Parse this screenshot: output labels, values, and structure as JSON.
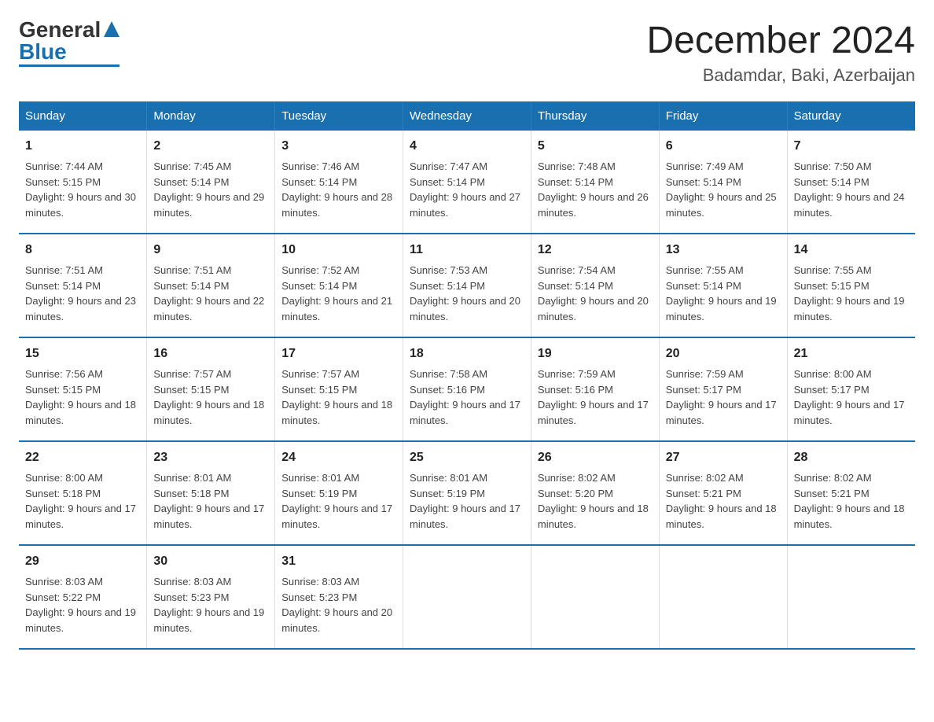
{
  "header": {
    "logo_general": "General",
    "logo_blue": "Blue",
    "main_title": "December 2024",
    "subtitle": "Badamdar, Baki, Azerbaijan"
  },
  "days_of_week": [
    "Sunday",
    "Monday",
    "Tuesday",
    "Wednesday",
    "Thursday",
    "Friday",
    "Saturday"
  ],
  "weeks": [
    [
      {
        "day": "1",
        "sunrise": "7:44 AM",
        "sunset": "5:15 PM",
        "daylight": "9 hours and 30 minutes."
      },
      {
        "day": "2",
        "sunrise": "7:45 AM",
        "sunset": "5:14 PM",
        "daylight": "9 hours and 29 minutes."
      },
      {
        "day": "3",
        "sunrise": "7:46 AM",
        "sunset": "5:14 PM",
        "daylight": "9 hours and 28 minutes."
      },
      {
        "day": "4",
        "sunrise": "7:47 AM",
        "sunset": "5:14 PM",
        "daylight": "9 hours and 27 minutes."
      },
      {
        "day": "5",
        "sunrise": "7:48 AM",
        "sunset": "5:14 PM",
        "daylight": "9 hours and 26 minutes."
      },
      {
        "day": "6",
        "sunrise": "7:49 AM",
        "sunset": "5:14 PM",
        "daylight": "9 hours and 25 minutes."
      },
      {
        "day": "7",
        "sunrise": "7:50 AM",
        "sunset": "5:14 PM",
        "daylight": "9 hours and 24 minutes."
      }
    ],
    [
      {
        "day": "8",
        "sunrise": "7:51 AM",
        "sunset": "5:14 PM",
        "daylight": "9 hours and 23 minutes."
      },
      {
        "day": "9",
        "sunrise": "7:51 AM",
        "sunset": "5:14 PM",
        "daylight": "9 hours and 22 minutes."
      },
      {
        "day": "10",
        "sunrise": "7:52 AM",
        "sunset": "5:14 PM",
        "daylight": "9 hours and 21 minutes."
      },
      {
        "day": "11",
        "sunrise": "7:53 AM",
        "sunset": "5:14 PM",
        "daylight": "9 hours and 20 minutes."
      },
      {
        "day": "12",
        "sunrise": "7:54 AM",
        "sunset": "5:14 PM",
        "daylight": "9 hours and 20 minutes."
      },
      {
        "day": "13",
        "sunrise": "7:55 AM",
        "sunset": "5:14 PM",
        "daylight": "9 hours and 19 minutes."
      },
      {
        "day": "14",
        "sunrise": "7:55 AM",
        "sunset": "5:15 PM",
        "daylight": "9 hours and 19 minutes."
      }
    ],
    [
      {
        "day": "15",
        "sunrise": "7:56 AM",
        "sunset": "5:15 PM",
        "daylight": "9 hours and 18 minutes."
      },
      {
        "day": "16",
        "sunrise": "7:57 AM",
        "sunset": "5:15 PM",
        "daylight": "9 hours and 18 minutes."
      },
      {
        "day": "17",
        "sunrise": "7:57 AM",
        "sunset": "5:15 PM",
        "daylight": "9 hours and 18 minutes."
      },
      {
        "day": "18",
        "sunrise": "7:58 AM",
        "sunset": "5:16 PM",
        "daylight": "9 hours and 17 minutes."
      },
      {
        "day": "19",
        "sunrise": "7:59 AM",
        "sunset": "5:16 PM",
        "daylight": "9 hours and 17 minutes."
      },
      {
        "day": "20",
        "sunrise": "7:59 AM",
        "sunset": "5:17 PM",
        "daylight": "9 hours and 17 minutes."
      },
      {
        "day": "21",
        "sunrise": "8:00 AM",
        "sunset": "5:17 PM",
        "daylight": "9 hours and 17 minutes."
      }
    ],
    [
      {
        "day": "22",
        "sunrise": "8:00 AM",
        "sunset": "5:18 PM",
        "daylight": "9 hours and 17 minutes."
      },
      {
        "day": "23",
        "sunrise": "8:01 AM",
        "sunset": "5:18 PM",
        "daylight": "9 hours and 17 minutes."
      },
      {
        "day": "24",
        "sunrise": "8:01 AM",
        "sunset": "5:19 PM",
        "daylight": "9 hours and 17 minutes."
      },
      {
        "day": "25",
        "sunrise": "8:01 AM",
        "sunset": "5:19 PM",
        "daylight": "9 hours and 17 minutes."
      },
      {
        "day": "26",
        "sunrise": "8:02 AM",
        "sunset": "5:20 PM",
        "daylight": "9 hours and 18 minutes."
      },
      {
        "day": "27",
        "sunrise": "8:02 AM",
        "sunset": "5:21 PM",
        "daylight": "9 hours and 18 minutes."
      },
      {
        "day": "28",
        "sunrise": "8:02 AM",
        "sunset": "5:21 PM",
        "daylight": "9 hours and 18 minutes."
      }
    ],
    [
      {
        "day": "29",
        "sunrise": "8:03 AM",
        "sunset": "5:22 PM",
        "daylight": "9 hours and 19 minutes."
      },
      {
        "day": "30",
        "sunrise": "8:03 AM",
        "sunset": "5:23 PM",
        "daylight": "9 hours and 19 minutes."
      },
      {
        "day": "31",
        "sunrise": "8:03 AM",
        "sunset": "5:23 PM",
        "daylight": "9 hours and 20 minutes."
      },
      null,
      null,
      null,
      null
    ]
  ]
}
